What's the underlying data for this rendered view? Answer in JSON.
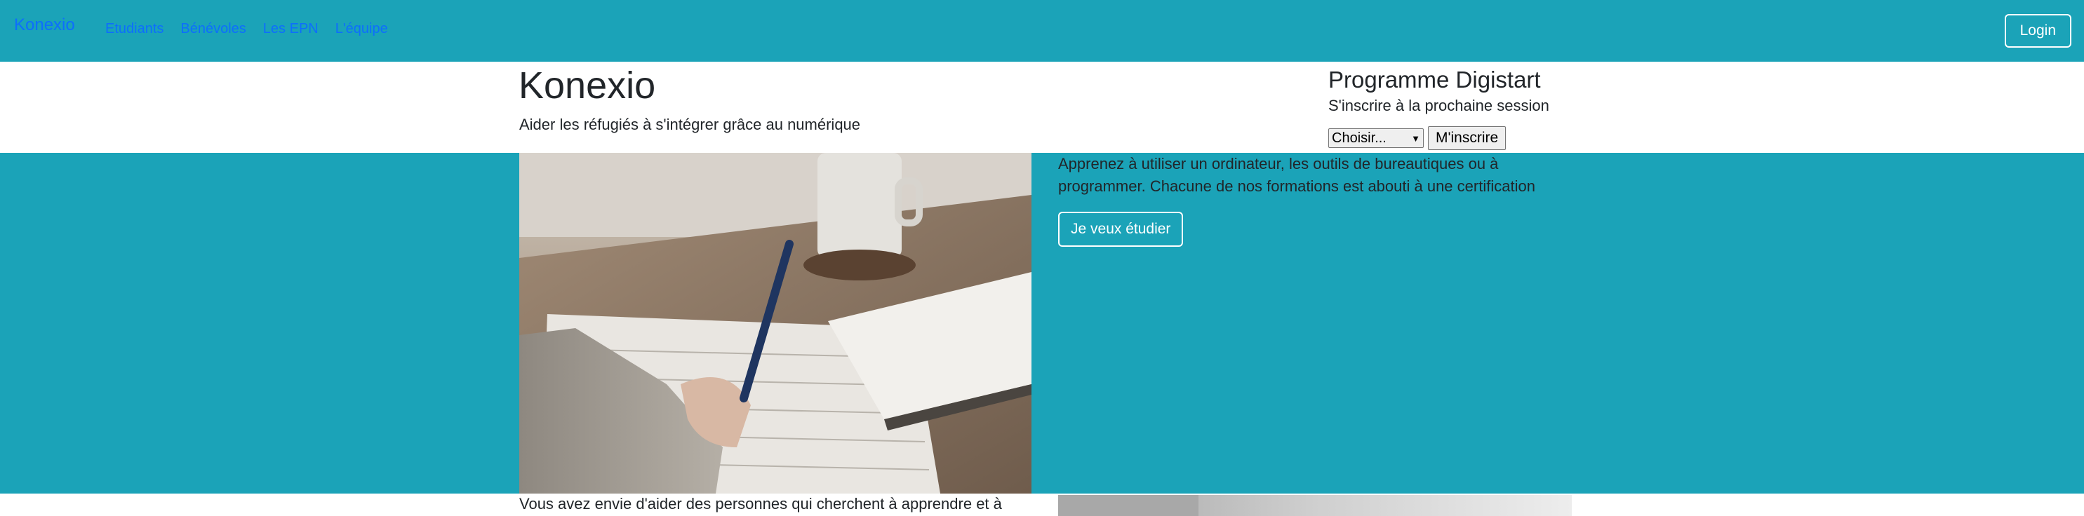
{
  "navbar": {
    "brand": "Konexio",
    "links": [
      "Etudiants",
      "Bénévoles",
      "Les EPN",
      "L'équipe"
    ],
    "login_label": "Login"
  },
  "header": {
    "title": "Konexio",
    "subtitle": "Aider les réfugiés à s'intégrer grâce au numérique"
  },
  "program": {
    "title": "Programme Digistart",
    "subtitle": "S'inscrire à la prochaine session",
    "select_value": "Choisir...",
    "submit_label": "M'inscrire"
  },
  "students": {
    "text_line1": "Apprenez à utiliser un ordinateur, les outils de bureautiques ou à",
    "text_line2": "programmer. Chacune de nos formations est abouti à une certification",
    "cta_label": "Je veux étudier"
  },
  "volunteers": {
    "text": "Vous avez envie d'aider des personnes qui cherchent à apprendre et à"
  },
  "colors": {
    "accent": "#1ba3b8",
    "link": "#0d6efd",
    "text": "#212529"
  }
}
